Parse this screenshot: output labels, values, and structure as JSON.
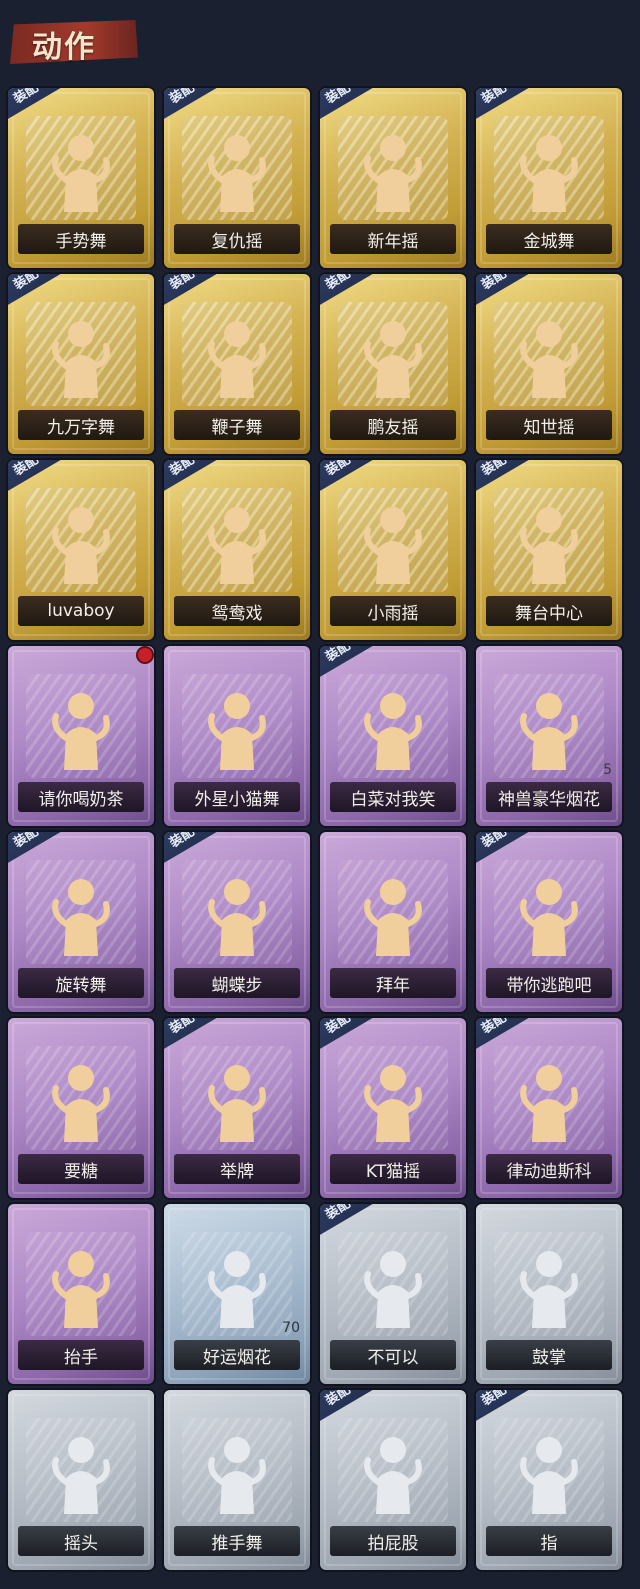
{
  "header": {
    "title": "动作"
  },
  "equip_label": "装配",
  "cards": [
    {
      "name": "手势舞",
      "tier": "gold",
      "equipped": true
    },
    {
      "name": "复仇摇",
      "tier": "gold",
      "equipped": true
    },
    {
      "name": "新年摇",
      "tier": "gold",
      "equipped": true
    },
    {
      "name": "金城舞",
      "tier": "gold",
      "equipped": true
    },
    {
      "name": "九万字舞",
      "tier": "gold",
      "equipped": true
    },
    {
      "name": "鞭子舞",
      "tier": "gold",
      "equipped": true
    },
    {
      "name": "鹏友摇",
      "tier": "gold",
      "equipped": true
    },
    {
      "name": "知世摇",
      "tier": "gold",
      "equipped": true
    },
    {
      "name": "luvaboy",
      "tier": "gold",
      "equipped": true
    },
    {
      "name": "鸳鸯戏",
      "tier": "gold",
      "equipped": true
    },
    {
      "name": "小雨摇",
      "tier": "gold",
      "equipped": true
    },
    {
      "name": "舞台中心",
      "tier": "gold",
      "equipped": true
    },
    {
      "name": "请你喝奶茶",
      "tier": "purple",
      "equipped": false,
      "new": true
    },
    {
      "name": "外星小猫舞",
      "tier": "purple",
      "equipped": false
    },
    {
      "name": "白菜对我笑",
      "tier": "purple",
      "equipped": true
    },
    {
      "name": "神兽豪华烟花",
      "tier": "purple",
      "equipped": false,
      "count": "5"
    },
    {
      "name": "旋转舞",
      "tier": "purple",
      "equipped": true
    },
    {
      "name": "蝴蝶步",
      "tier": "purple",
      "equipped": true
    },
    {
      "name": "拜年",
      "tier": "purple",
      "equipped": false
    },
    {
      "name": "带你逃跑吧",
      "tier": "purple",
      "equipped": true
    },
    {
      "name": "要糖",
      "tier": "purple",
      "equipped": false
    },
    {
      "name": "举牌",
      "tier": "purple",
      "equipped": true
    },
    {
      "name": "KT猫摇",
      "tier": "purple",
      "equipped": true
    },
    {
      "name": "律动迪斯科",
      "tier": "purple",
      "equipped": true
    },
    {
      "name": "抬手",
      "tier": "purple",
      "equipped": false
    },
    {
      "name": "好运烟花",
      "tier": "blue",
      "equipped": false,
      "count": "70"
    },
    {
      "name": "不可以",
      "tier": "silver",
      "equipped": true
    },
    {
      "name": "鼓掌",
      "tier": "silver",
      "equipped": false
    },
    {
      "name": "摇头",
      "tier": "silver",
      "equipped": false
    },
    {
      "name": "推手舞",
      "tier": "silver",
      "equipped": false
    },
    {
      "name": "拍屁股",
      "tier": "silver",
      "equipped": true
    },
    {
      "name": "指",
      "tier": "silver",
      "equipped": true
    }
  ]
}
